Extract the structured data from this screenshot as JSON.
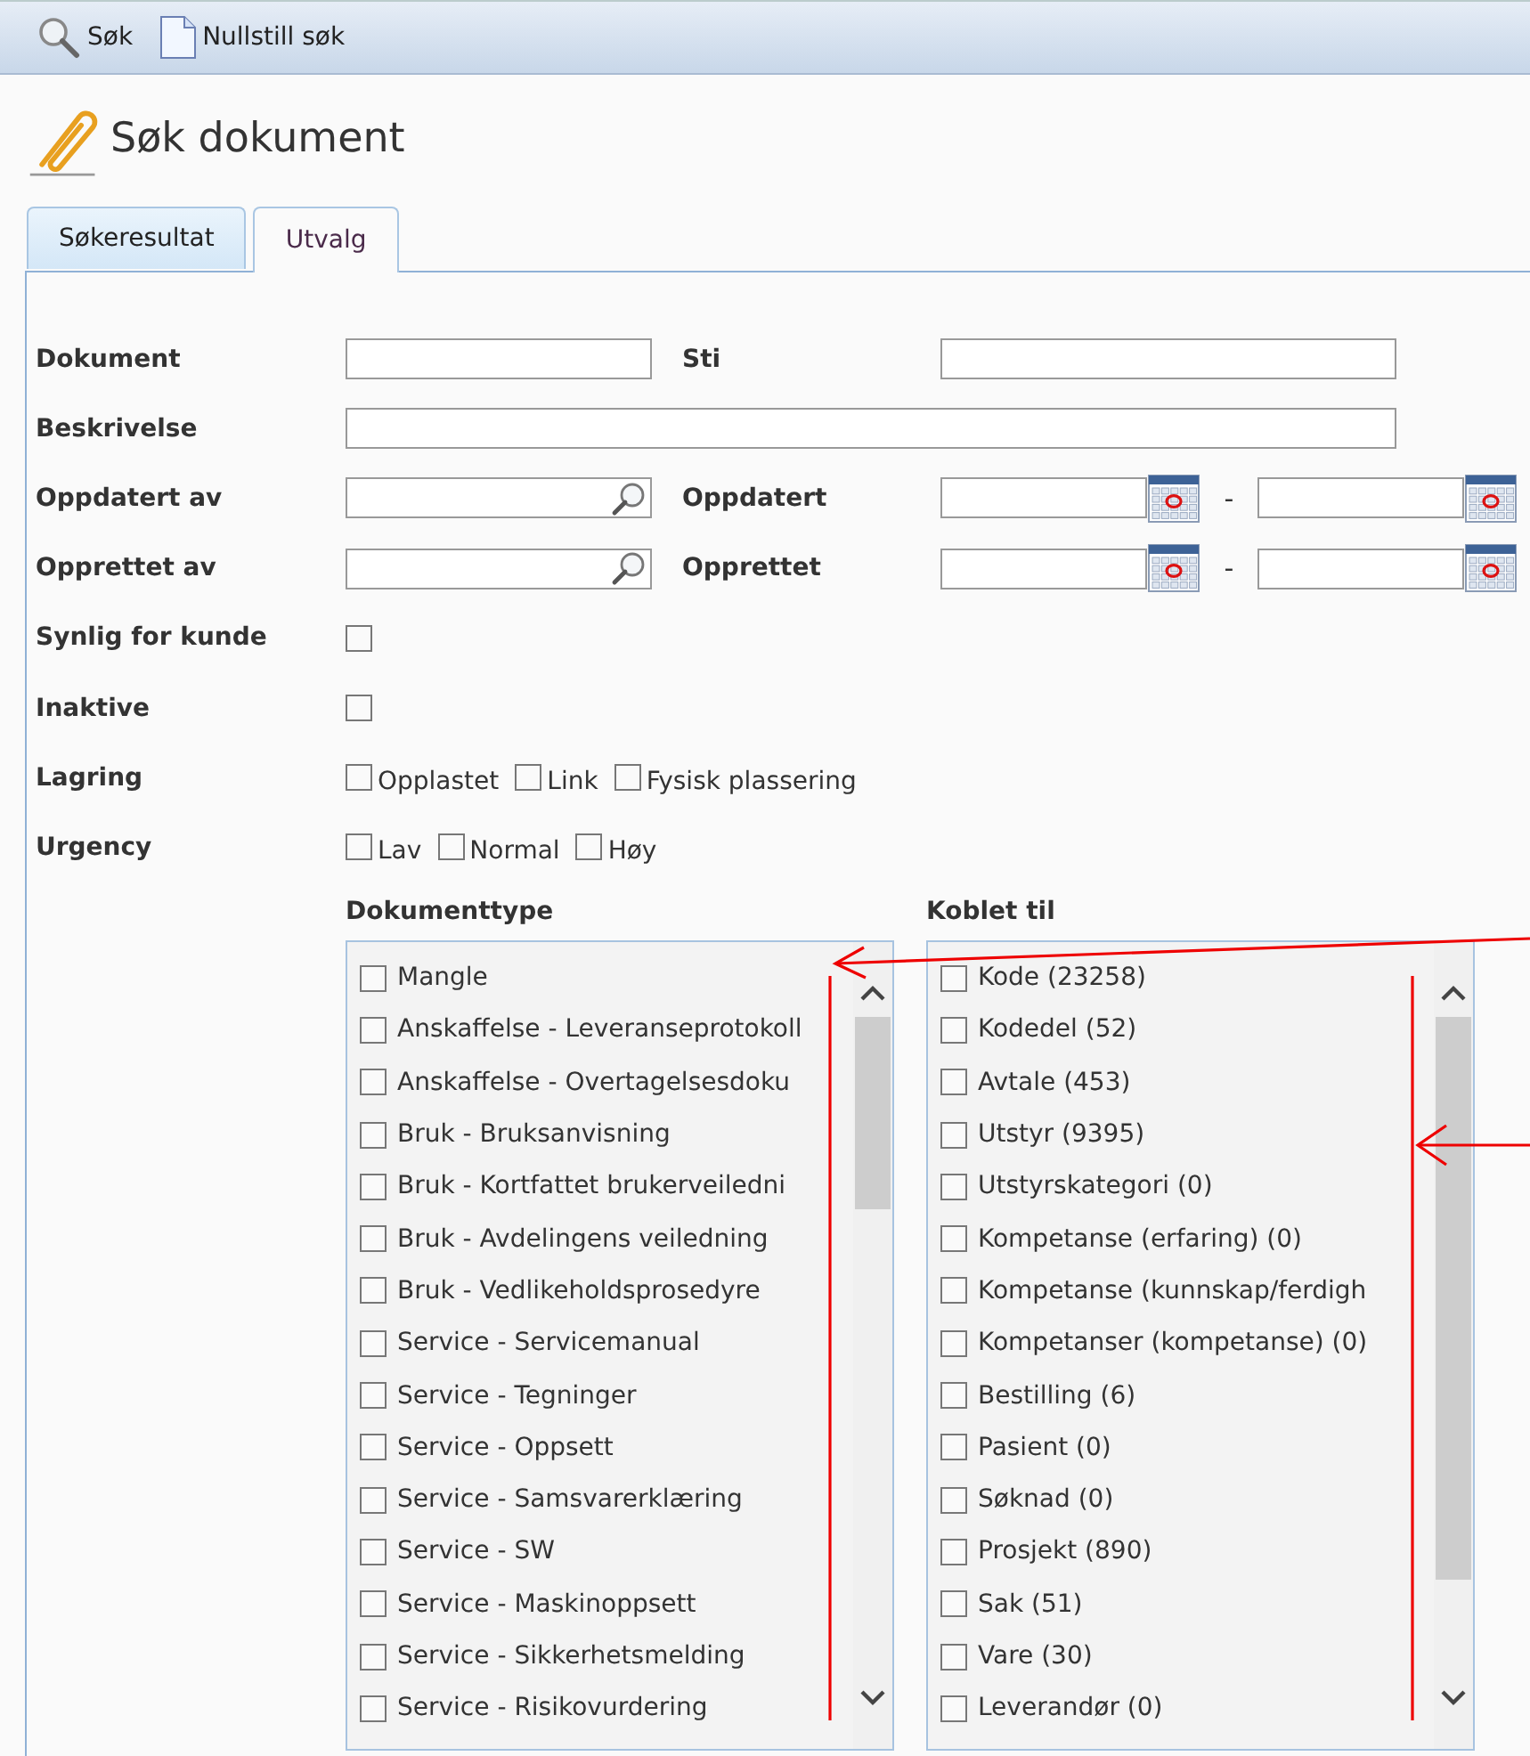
{
  "toolbar": [
    {
      "kind": "search",
      "label": "Søk"
    },
    {
      "kind": "reset",
      "label": "Nullstill søk"
    }
  ],
  "page_title": "Søk dokument",
  "tabs": [
    {
      "label": "Søkeresultat",
      "selected": false
    },
    {
      "label": "Utvalg",
      "selected": true
    }
  ],
  "rows": [
    {
      "kind": "text_pair",
      "label": "Dokument",
      "label_2": "Sti"
    },
    {
      "kind": "text_wide",
      "label": "Beskrivelse"
    },
    {
      "kind": "lookup_dates",
      "label": "Oppdatert av",
      "label_2": "Oppdatert",
      "separator": "-"
    },
    {
      "kind": "lookup_dates",
      "label": "Opprettet av",
      "label_2": "Opprettet",
      "separator": "-"
    },
    {
      "kind": "checkbox",
      "label": "Synlig for kunde",
      "checked": false
    },
    {
      "kind": "checkbox",
      "label": "Inaktive",
      "checked": false
    },
    {
      "kind": "options",
      "label": "Lagring",
      "options": [
        {
          "label": "Opplastet",
          "checked": false
        },
        {
          "label": "Link",
          "checked": false
        },
        {
          "label": "Fysisk plassering",
          "checked": false
        }
      ]
    },
    {
      "kind": "options",
      "label": "Urgency",
      "options": [
        {
          "label": "Lav",
          "checked": false
        },
        {
          "label": "Normal",
          "checked": false
        },
        {
          "label": "Høy",
          "checked": false
        }
      ]
    }
  ],
  "lists": [
    {
      "title": "Dokumenttype",
      "items": [
        {
          "label": "Mangle",
          "checked": false
        },
        {
          "label": "Anskaffelse - Leveranseprotokoll",
          "checked": false
        },
        {
          "label": "Anskaffelse - Overtagelsesdoku",
          "checked": false
        },
        {
          "label": "Bruk - Bruksanvisning",
          "checked": false
        },
        {
          "label": "Bruk - Kortfattet brukerveiledni",
          "checked": false
        },
        {
          "label": "Bruk - Avdelingens veiledning",
          "checked": false
        },
        {
          "label": "Bruk - Vedlikeholdsprosedyre",
          "checked": false
        },
        {
          "label": "Service - Servicemanual",
          "checked": false
        },
        {
          "label": "Service - Tegninger",
          "checked": false
        },
        {
          "label": "Service - Oppsett",
          "checked": false
        },
        {
          "label": "Service - Samsvarerklæring",
          "checked": false
        },
        {
          "label": "Service - SW",
          "checked": false
        },
        {
          "label": "Service - Maskinoppsett",
          "checked": false
        },
        {
          "label": "Service - Sikkerhetsmelding",
          "checked": false
        },
        {
          "label": "Service - Risikovurdering",
          "checked": false
        }
      ]
    },
    {
      "title": "Koblet til",
      "items": [
        {
          "label": "Kode (23258)",
          "checked": false
        },
        {
          "label": "Kodedel (52)",
          "checked": false
        },
        {
          "label": "Avtale (453)",
          "checked": false
        },
        {
          "label": "Utstyr (9395)",
          "checked": false
        },
        {
          "label": "Utstyrskategori (0)",
          "checked": false
        },
        {
          "label": "Kompetanse (erfaring) (0)",
          "checked": false
        },
        {
          "label": "Kompetanse (kunnskap/ferdigh",
          "checked": false
        },
        {
          "label": "Kompetanser (kompetanse) (0)",
          "checked": false
        },
        {
          "label": "Bestilling (6)",
          "checked": false
        },
        {
          "label": "Pasient (0)",
          "checked": false
        },
        {
          "label": "Søknad (0)",
          "checked": false
        },
        {
          "label": "Prosjekt (890)",
          "checked": false
        },
        {
          "label": "Sak (51)",
          "checked": false
        },
        {
          "label": "Vare (30)",
          "checked": false
        },
        {
          "label": "Leverandør (0)",
          "checked": false
        }
      ]
    }
  ]
}
